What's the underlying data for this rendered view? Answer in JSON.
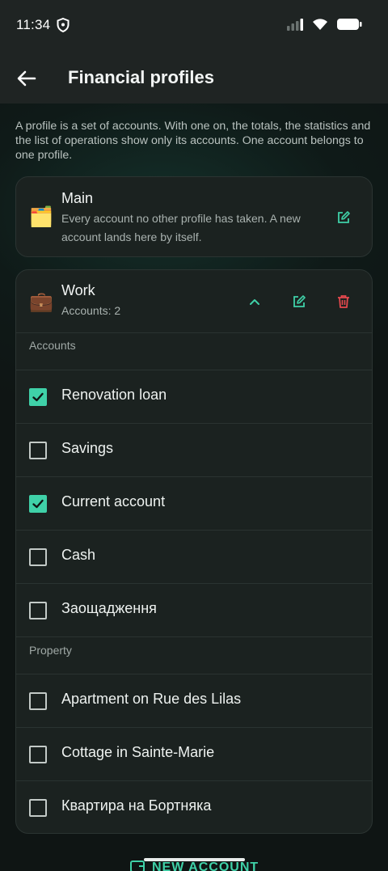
{
  "status_bar": {
    "time": "11:34"
  },
  "app_bar": {
    "title": "Financial profiles"
  },
  "intro": "A profile is a set of accounts. With one on, the totals, the statistics and the list of operations show only its accounts. One account belongs to one profile.",
  "profiles": {
    "main": {
      "emoji": "🗂️",
      "name": "Main",
      "description": "Every account no other profile has taken. A new account lands here by itself."
    },
    "work": {
      "emoji": "💼",
      "name": "Work",
      "count": "Accounts: 2",
      "sections": [
        {
          "label": "Accounts",
          "items": [
            {
              "label": "Renovation loan",
              "checked": true
            },
            {
              "label": "Savings",
              "checked": false
            },
            {
              "label": "Current account",
              "checked": true
            },
            {
              "label": "Cash",
              "checked": false
            },
            {
              "label": "Заощадження",
              "checked": false
            }
          ]
        },
        {
          "label": "Property",
          "items": [
            {
              "label": "Apartment on Rue des Lilas",
              "checked": false
            },
            {
              "label": "Cottage in Sainte-Marie",
              "checked": false
            },
            {
              "label": "Квартира на Бортняка",
              "checked": false
            }
          ]
        }
      ]
    }
  },
  "fab": {
    "label": "NEW ACCOUNT"
  },
  "colors": {
    "accent": "#3fd1a8",
    "danger": "#e5484d",
    "surface": "#1b2220",
    "background": "#0f1514"
  }
}
